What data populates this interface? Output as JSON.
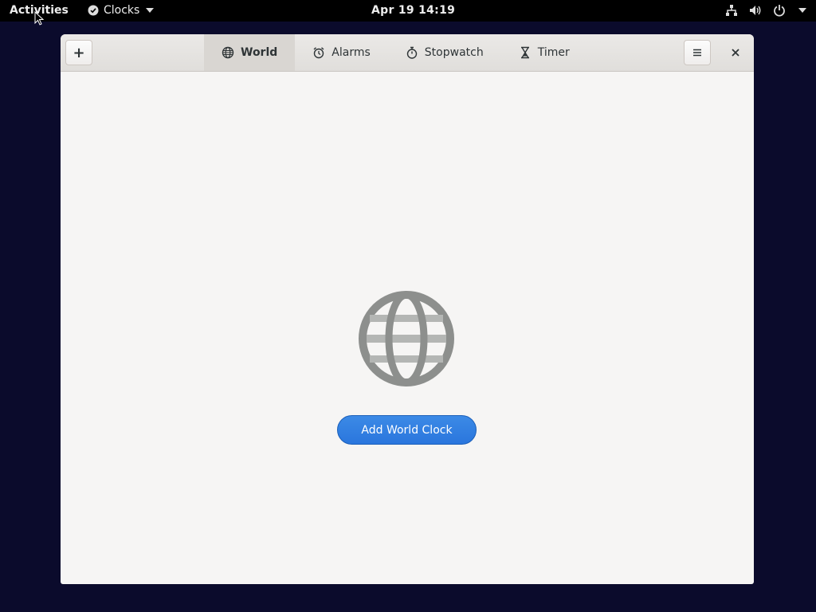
{
  "topbar": {
    "activities": "Activities",
    "app_name": "Clocks",
    "datetime": "Apr 19  14:19",
    "tray_icons": [
      "network-icon",
      "volume-icon",
      "power-icon",
      "tray-menu-caret-icon"
    ]
  },
  "headerbar": {
    "add_button_label": "+",
    "close_label": "✕",
    "tabs": [
      {
        "label": "World",
        "icon": "globe-icon",
        "active": true
      },
      {
        "label": "Alarms",
        "icon": "alarm-icon",
        "active": false
      },
      {
        "label": "Stopwatch",
        "icon": "stopwatch-icon",
        "active": false
      },
      {
        "label": "Timer",
        "icon": "hourglass-icon",
        "active": false
      }
    ]
  },
  "content": {
    "empty_icon": "globe-icon",
    "add_button_label": "Add World Clock"
  },
  "colors": {
    "accent": "#3584e4",
    "desktop_bg": "#0b0b2c",
    "window_bg": "#f6f5f4",
    "icon_gray": "#8d8f8d"
  }
}
